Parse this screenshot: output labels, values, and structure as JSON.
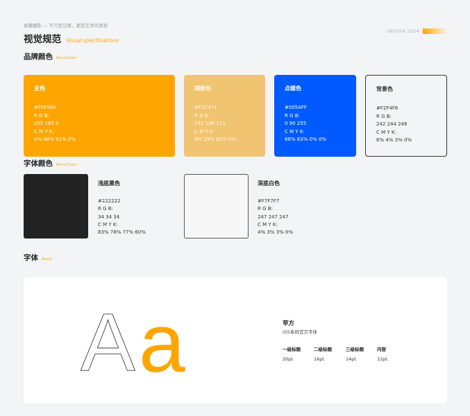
{
  "header": {
    "tagline": "星耀摄影 — 不只是记录，更是艺术的发现",
    "title": "视觉规范",
    "subtitle": "Visual specifications",
    "design_tag": "DESIGN 2024"
  },
  "sections": {
    "brand": {
      "title": "品牌颜色",
      "sub": "Brand Color"
    },
    "font_color": {
      "title": "字体颜色",
      "sub": "Brand Color"
    },
    "font": {
      "title": "字体",
      "sub": "Brand"
    }
  },
  "brand_colors": [
    {
      "name": "主色",
      "hex": "#FFA500",
      "rgb_label": "R G B:",
      "rgb": "255 165 0",
      "cmyk_label": "C M Y K:",
      "cmyk": "0% 46% 91% 0%",
      "fill": "#FFA500"
    },
    {
      "name": "辅助色",
      "hex": "#F1C471",
      "rgb_label": "R G B:",
      "rgb": "241 196 113",
      "cmyk_label": "C M Y K:",
      "cmyk": "9% 29% 61% 0%",
      "fill": "#F1C471"
    },
    {
      "name": "点缀色",
      "hex": "#005AFF",
      "rgb_label": "R G B:",
      "rgb": "0 90 255",
      "cmyk_label": "C M Y K:",
      "cmyk": "86% 63% 0% 0%",
      "fill": "#005AFF"
    },
    {
      "name": "背景色",
      "hex": "#F2F4F6",
      "rgb_label": "R G B:",
      "rgb": "242 244 246",
      "cmyk_label": "C M Y K:",
      "cmyk": "6% 4% 3% 0%",
      "fill": "#F2F4F6"
    }
  ],
  "font_colors": [
    {
      "name": "浅底黑色",
      "hex": "#222222",
      "rgb_label": "R G B:",
      "rgb": "34 34 34",
      "cmyk_label": "C M Y K:",
      "cmyk": "83% 78% 77% 60%",
      "fill": "#222222"
    },
    {
      "name": "深底白色",
      "hex": "#F7F7F7",
      "rgb_label": "R G B:",
      "rgb": "247 247 247",
      "cmyk_label": "C M Y K:",
      "cmyk": "4% 3% 3% 0%",
      "fill": "#F7F7F7"
    }
  ],
  "typography": {
    "sample_upper": "A",
    "sample_lower": "a",
    "font_name": "苹方",
    "font_desc": "iOS系统官方字体",
    "levels": [
      {
        "label": "一级标题",
        "size": "20pt"
      },
      {
        "label": "二级标题",
        "size": "16pt"
      },
      {
        "label": "三级标题",
        "size": "14pt"
      },
      {
        "label": "内容",
        "size": "12pt"
      }
    ]
  },
  "colors": {
    "accent": "#FFA500",
    "page_bg": "#F2F4F6",
    "text_dark": "#222222"
  }
}
